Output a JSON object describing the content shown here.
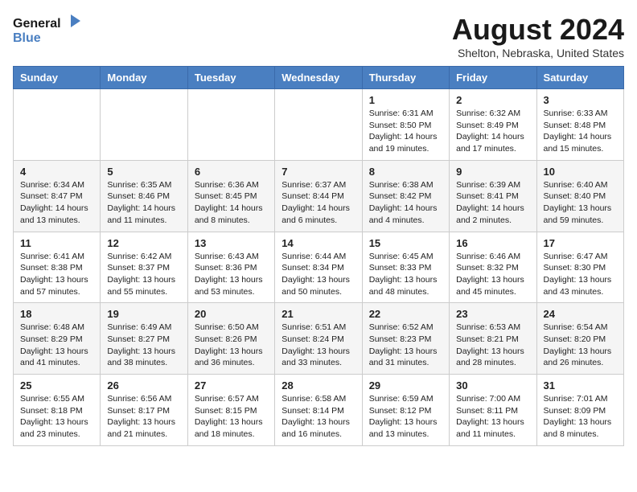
{
  "logo": {
    "line1": "General",
    "line2": "Blue"
  },
  "title": "August 2024",
  "location": "Shelton, Nebraska, United States",
  "days_of_week": [
    "Sunday",
    "Monday",
    "Tuesday",
    "Wednesday",
    "Thursday",
    "Friday",
    "Saturday"
  ],
  "weeks": [
    [
      {
        "date": "",
        "info": ""
      },
      {
        "date": "",
        "info": ""
      },
      {
        "date": "",
        "info": ""
      },
      {
        "date": "",
        "info": ""
      },
      {
        "date": "1",
        "info": "Sunrise: 6:31 AM\nSunset: 8:50 PM\nDaylight: 14 hours and 19 minutes."
      },
      {
        "date": "2",
        "info": "Sunrise: 6:32 AM\nSunset: 8:49 PM\nDaylight: 14 hours and 17 minutes."
      },
      {
        "date": "3",
        "info": "Sunrise: 6:33 AM\nSunset: 8:48 PM\nDaylight: 14 hours and 15 minutes."
      }
    ],
    [
      {
        "date": "4",
        "info": "Sunrise: 6:34 AM\nSunset: 8:47 PM\nDaylight: 14 hours and 13 minutes."
      },
      {
        "date": "5",
        "info": "Sunrise: 6:35 AM\nSunset: 8:46 PM\nDaylight: 14 hours and 11 minutes."
      },
      {
        "date": "6",
        "info": "Sunrise: 6:36 AM\nSunset: 8:45 PM\nDaylight: 14 hours and 8 minutes."
      },
      {
        "date": "7",
        "info": "Sunrise: 6:37 AM\nSunset: 8:44 PM\nDaylight: 14 hours and 6 minutes."
      },
      {
        "date": "8",
        "info": "Sunrise: 6:38 AM\nSunset: 8:42 PM\nDaylight: 14 hours and 4 minutes."
      },
      {
        "date": "9",
        "info": "Sunrise: 6:39 AM\nSunset: 8:41 PM\nDaylight: 14 hours and 2 minutes."
      },
      {
        "date": "10",
        "info": "Sunrise: 6:40 AM\nSunset: 8:40 PM\nDaylight: 13 hours and 59 minutes."
      }
    ],
    [
      {
        "date": "11",
        "info": "Sunrise: 6:41 AM\nSunset: 8:38 PM\nDaylight: 13 hours and 57 minutes."
      },
      {
        "date": "12",
        "info": "Sunrise: 6:42 AM\nSunset: 8:37 PM\nDaylight: 13 hours and 55 minutes."
      },
      {
        "date": "13",
        "info": "Sunrise: 6:43 AM\nSunset: 8:36 PM\nDaylight: 13 hours and 53 minutes."
      },
      {
        "date": "14",
        "info": "Sunrise: 6:44 AM\nSunset: 8:34 PM\nDaylight: 13 hours and 50 minutes."
      },
      {
        "date": "15",
        "info": "Sunrise: 6:45 AM\nSunset: 8:33 PM\nDaylight: 13 hours and 48 minutes."
      },
      {
        "date": "16",
        "info": "Sunrise: 6:46 AM\nSunset: 8:32 PM\nDaylight: 13 hours and 45 minutes."
      },
      {
        "date": "17",
        "info": "Sunrise: 6:47 AM\nSunset: 8:30 PM\nDaylight: 13 hours and 43 minutes."
      }
    ],
    [
      {
        "date": "18",
        "info": "Sunrise: 6:48 AM\nSunset: 8:29 PM\nDaylight: 13 hours and 41 minutes."
      },
      {
        "date": "19",
        "info": "Sunrise: 6:49 AM\nSunset: 8:27 PM\nDaylight: 13 hours and 38 minutes."
      },
      {
        "date": "20",
        "info": "Sunrise: 6:50 AM\nSunset: 8:26 PM\nDaylight: 13 hours and 36 minutes."
      },
      {
        "date": "21",
        "info": "Sunrise: 6:51 AM\nSunset: 8:24 PM\nDaylight: 13 hours and 33 minutes."
      },
      {
        "date": "22",
        "info": "Sunrise: 6:52 AM\nSunset: 8:23 PM\nDaylight: 13 hours and 31 minutes."
      },
      {
        "date": "23",
        "info": "Sunrise: 6:53 AM\nSunset: 8:21 PM\nDaylight: 13 hours and 28 minutes."
      },
      {
        "date": "24",
        "info": "Sunrise: 6:54 AM\nSunset: 8:20 PM\nDaylight: 13 hours and 26 minutes."
      }
    ],
    [
      {
        "date": "25",
        "info": "Sunrise: 6:55 AM\nSunset: 8:18 PM\nDaylight: 13 hours and 23 minutes."
      },
      {
        "date": "26",
        "info": "Sunrise: 6:56 AM\nSunset: 8:17 PM\nDaylight: 13 hours and 21 minutes."
      },
      {
        "date": "27",
        "info": "Sunrise: 6:57 AM\nSunset: 8:15 PM\nDaylight: 13 hours and 18 minutes."
      },
      {
        "date": "28",
        "info": "Sunrise: 6:58 AM\nSunset: 8:14 PM\nDaylight: 13 hours and 16 minutes."
      },
      {
        "date": "29",
        "info": "Sunrise: 6:59 AM\nSunset: 8:12 PM\nDaylight: 13 hours and 13 minutes."
      },
      {
        "date": "30",
        "info": "Sunrise: 7:00 AM\nSunset: 8:11 PM\nDaylight: 13 hours and 11 minutes."
      },
      {
        "date": "31",
        "info": "Sunrise: 7:01 AM\nSunset: 8:09 PM\nDaylight: 13 hours and 8 minutes."
      }
    ]
  ]
}
